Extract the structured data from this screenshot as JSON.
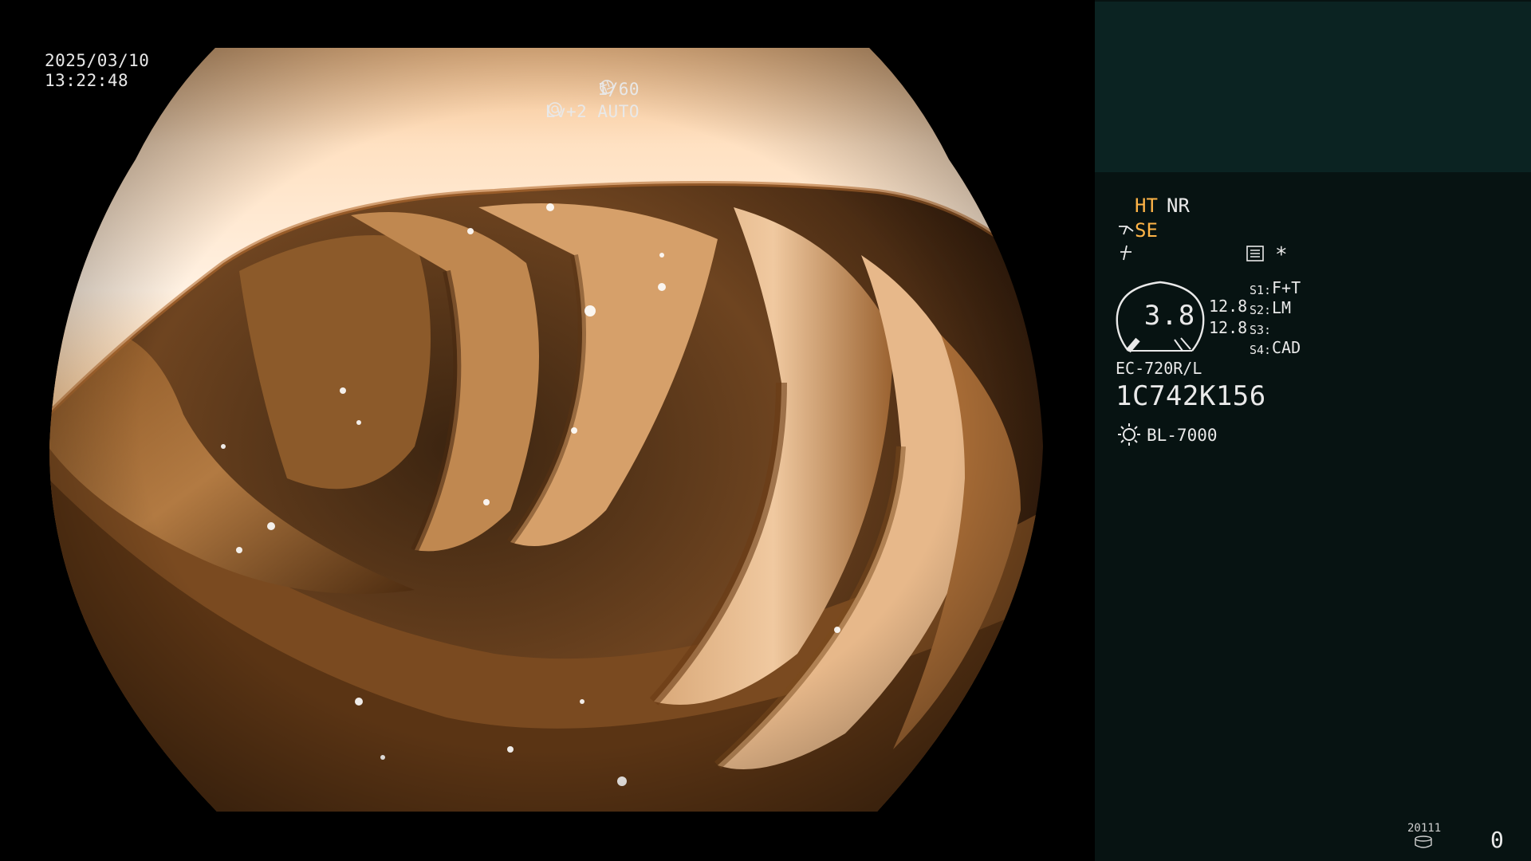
{
  "overlay": {
    "date": "2025/03/10",
    "time": "13:22:48",
    "shutter": "1/60",
    "level": "Lv+2 AUTO",
    "icons": [
      "shutter-icon",
      "iris-icon"
    ]
  },
  "panel": {
    "ht": "HT",
    "nr": "NR",
    "se": "SE",
    "star": "*",
    "zoom": "3.8",
    "value_a": "12.8",
    "value_b": "12.8",
    "switches": [
      {
        "key": "S1:",
        "value": "F+T"
      },
      {
        "key": "S2:",
        "value": "LM"
      },
      {
        "key": "S3:",
        "value": ""
      },
      {
        "key": "S4:",
        "value": "CAD"
      }
    ],
    "scope_model": "EC-720R/L",
    "scope_serial": "1C742K156",
    "light_source": "BL-7000",
    "storage_number": "20111",
    "count": "0",
    "icons": [
      "scope-icon",
      "freeze-icon",
      "menu-icon",
      "zoom-gauge-icon",
      "light-icon",
      "storage-icon"
    ]
  },
  "colors": {
    "accent_orange": "#ffb447",
    "panel_bg": "#071312",
    "thumb_bg": "#0b2322",
    "text": "#e9e9e9"
  }
}
